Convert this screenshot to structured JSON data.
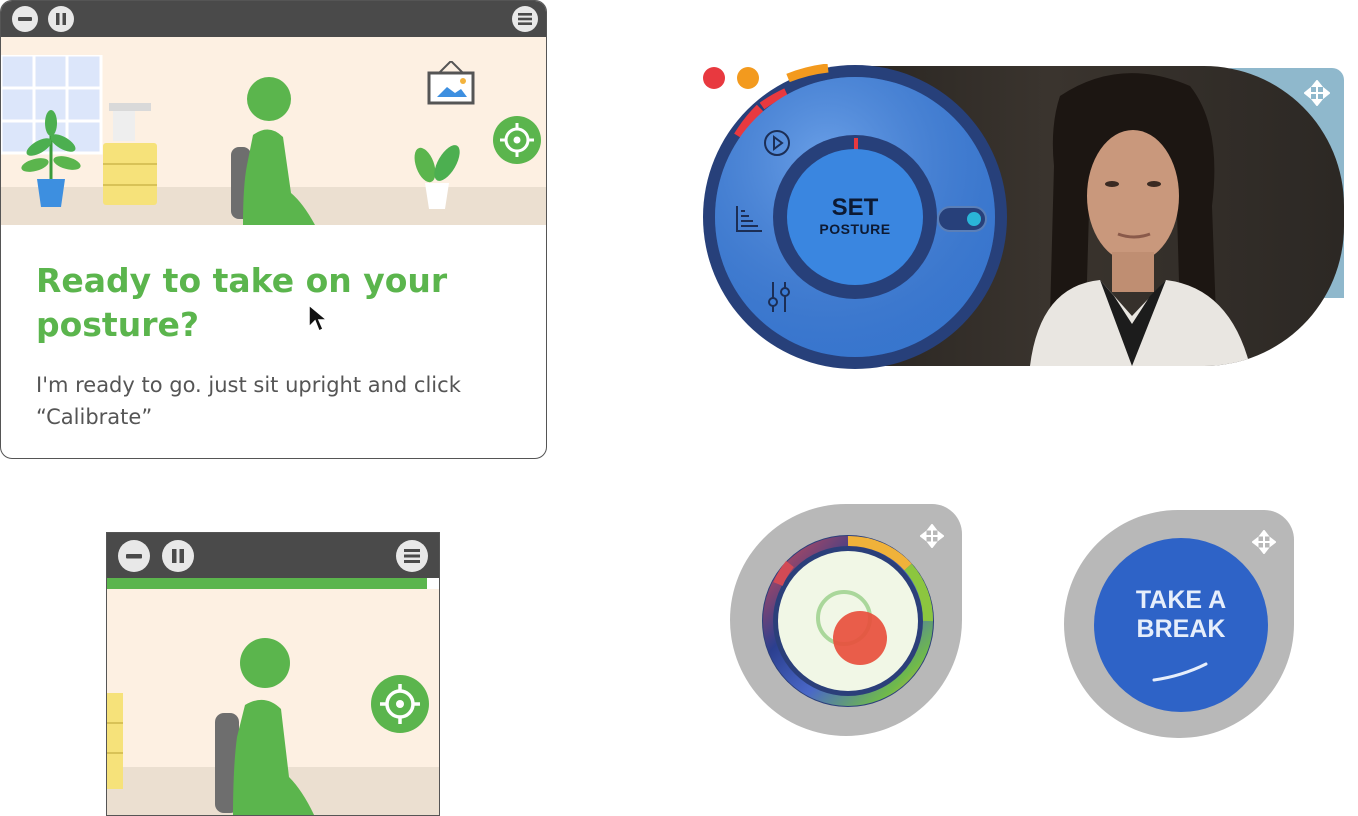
{
  "intro_window": {
    "heading": "Ready to take on your posture?",
    "body": "I'm ready to go. just sit upright and click “Calibrate”",
    "icons": [
      "minimize-icon",
      "pause-icon",
      "menu-icon",
      "calibrate-target-icon"
    ]
  },
  "mini_window": {
    "progress": 1.0,
    "icons": [
      "minimize-icon",
      "pause-icon",
      "menu-icon",
      "calibrate-target-icon"
    ]
  },
  "camera_widget": {
    "set_button_line1": "SET",
    "set_button_line2": "POSTURE",
    "toggle_on": true,
    "icons": [
      "close-dot-icon",
      "minimize-dot-icon",
      "play-icon",
      "stats-icon",
      "settings-sliders-icon",
      "move-icon"
    ]
  },
  "posture_gauge": {
    "icons": [
      "move-icon"
    ]
  },
  "break_widget": {
    "line1": "TAKE A",
    "line2": "BREAK",
    "icons": [
      "move-icon",
      "smile-icon"
    ]
  },
  "colors": {
    "brand_green": "#5bb54d",
    "titlebar": "#4a4a4a",
    "scene_bg": "#fdf0e2",
    "widget_blue": "#3a7bd5",
    "ring_navy": "#27407a",
    "break_blue": "#2e63c7",
    "red_dot": "#e8393f",
    "orange_dot": "#f39a1e"
  }
}
